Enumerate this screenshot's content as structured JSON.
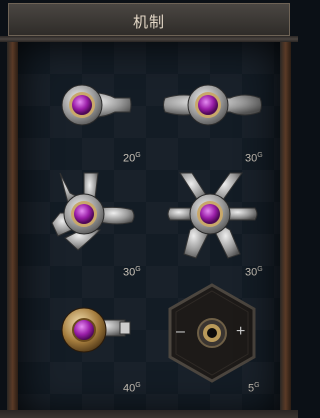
{
  "header": {
    "title": "机制"
  },
  "items": [
    {
      "name": "item-1",
      "price": "20",
      "currency": "G"
    },
    {
      "name": "item-2",
      "price": "30",
      "currency": "G"
    },
    {
      "name": "item-3",
      "price": "30",
      "currency": "G"
    },
    {
      "name": "item-4",
      "price": "30",
      "currency": "G"
    },
    {
      "name": "item-5",
      "price": "40",
      "currency": "G"
    },
    {
      "name": "item-6",
      "price": "5",
      "currency": "G"
    }
  ],
  "adjuster": {
    "minus": "–",
    "plus": "+"
  }
}
